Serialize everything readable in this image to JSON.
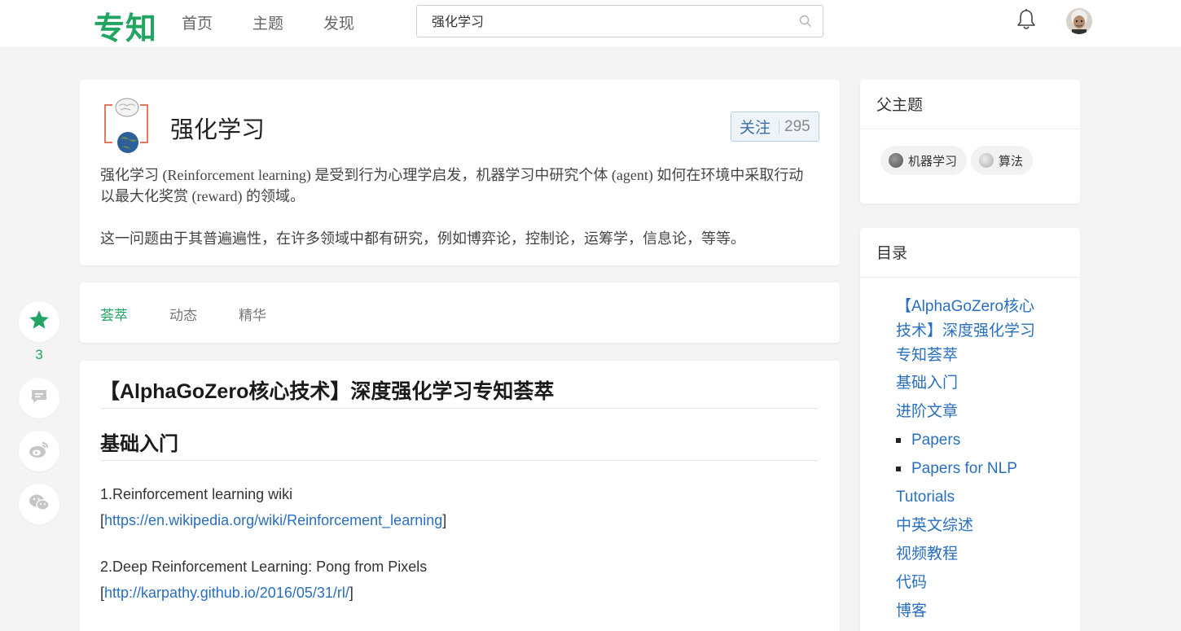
{
  "header": {
    "logo": "专知",
    "nav": [
      "首页",
      "主题",
      "发现"
    ],
    "search_value": "强化学习"
  },
  "topic": {
    "title": "强化学习",
    "follow_label": "关注",
    "follow_count": "295",
    "desc1": "强化学习 (Reinforcement learning) 是受到行为心理学启发，机器学习中研究个体 (agent) 如何在环境中采取行动以最大化奖赏 (reward) 的领域。",
    "desc2": "这一问题由于其普遍遍性，在许多领域中都有研究，例如博弈论，控制论，运筹学，信息论，等等。"
  },
  "tabs": [
    {
      "label": "荟萃",
      "active": true
    },
    {
      "label": "动态",
      "active": false
    },
    {
      "label": "精华",
      "active": false
    }
  ],
  "article": {
    "title": "【AlphaGoZero核心技术】深度强化学习专知荟萃",
    "section": "基础入门",
    "refs": [
      {
        "text": "1.Reinforcement learning wiki",
        "link": "https://en.wikipedia.org/wiki/Reinforcement_learning"
      },
      {
        "text": "2.Deep Reinforcement Learning: Pong from Pixels",
        "link": "http://karpathy.github.io/2016/05/31/rl/"
      }
    ]
  },
  "floatbar": {
    "star_count": "3"
  },
  "parent_topics": {
    "title": "父主题",
    "items": [
      "机器学习",
      "算法"
    ]
  },
  "toc": {
    "title": "目录",
    "items": [
      "【AlphaGoZero核心",
      "技术】深度强化学习",
      "专知荟萃",
      "基础入门",
      "进阶文章",
      "Papers",
      "Papers for NLP",
      "Tutorials",
      "中英文综述",
      "视频教程",
      "代码",
      "博客"
    ]
  },
  "colors": {
    "brand": "#22a463",
    "link": "#2a6fbe"
  }
}
